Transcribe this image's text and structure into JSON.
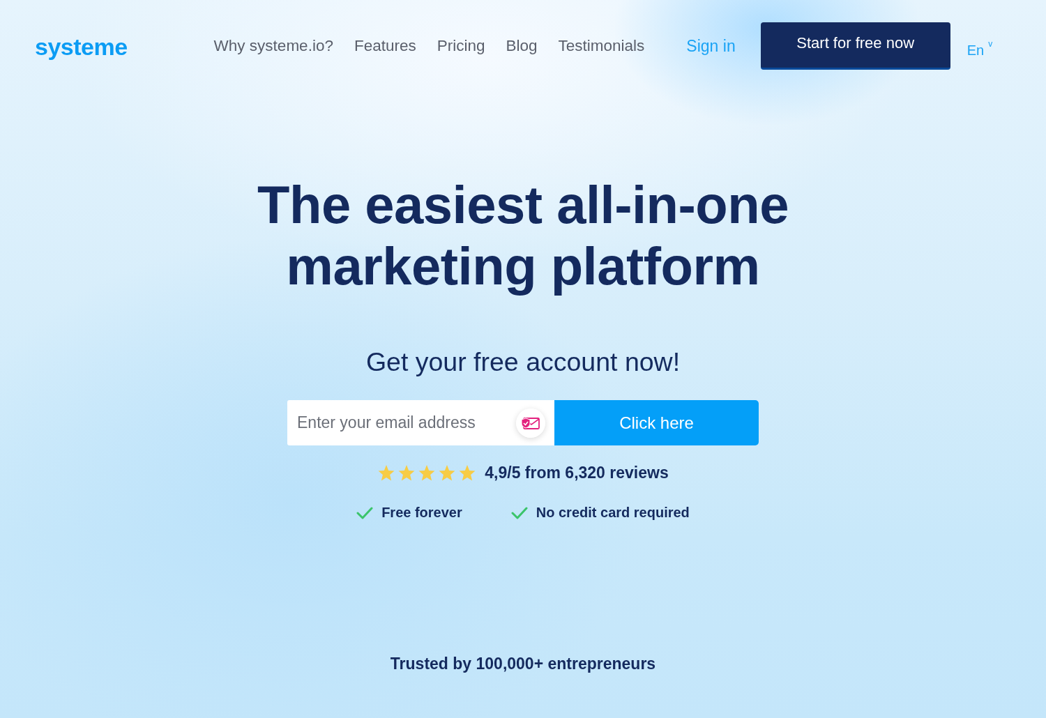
{
  "header": {
    "logo": "systeme",
    "nav": [
      "Why systeme.io?",
      "Features",
      "Pricing",
      "Blog",
      "Testimonials"
    ],
    "sign_in": "Sign in",
    "cta": "Start for free now",
    "language": {
      "label": "En",
      "caret": "v"
    }
  },
  "hero": {
    "title": "The easiest all-in-one marketing platform",
    "subtitle": "Get your free account now!",
    "email_field": {
      "placeholder": "Enter your email address"
    },
    "submit": "Click here",
    "rating": {
      "stars": 5,
      "text": "4,9/5 from 6,320 reviews"
    },
    "benefits": [
      "Free forever",
      "No credit card required"
    ],
    "trusted": "Trusted by 100,000+ entrepreneurs"
  }
}
